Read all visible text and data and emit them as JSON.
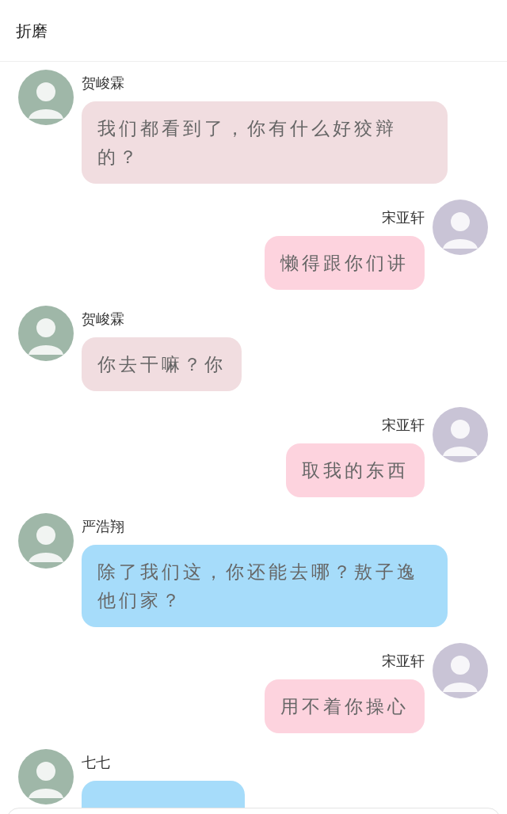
{
  "header": {
    "title": "折磨"
  },
  "messages": [
    {
      "kind": "incoming",
      "name": "贺峻霖",
      "text": "我们都看到了，你有什么好狡辩的？",
      "color": "#f1dde0"
    },
    {
      "kind": "outgoing",
      "name": "宋亚轩",
      "text": "懒得跟你们讲",
      "color": "#fdd3de"
    },
    {
      "kind": "incoming",
      "name": "贺峻霖",
      "text": "你去干嘛？你",
      "color": "#f1dde0"
    },
    {
      "kind": "outgoing",
      "name": "宋亚轩",
      "text": "取我的东西",
      "color": "#fdd3de"
    },
    {
      "kind": "incoming",
      "name": "严浩翔",
      "text": "除了我们这，你还能去哪？敖子逸他们家？",
      "color": "#a6dcfa"
    },
    {
      "kind": "outgoing",
      "name": "宋亚轩",
      "text": "用不着你操心",
      "color": "#fdd3de"
    },
    {
      "kind": "incoming",
      "name": "七七",
      "color": "#a6dcfa"
    }
  ]
}
